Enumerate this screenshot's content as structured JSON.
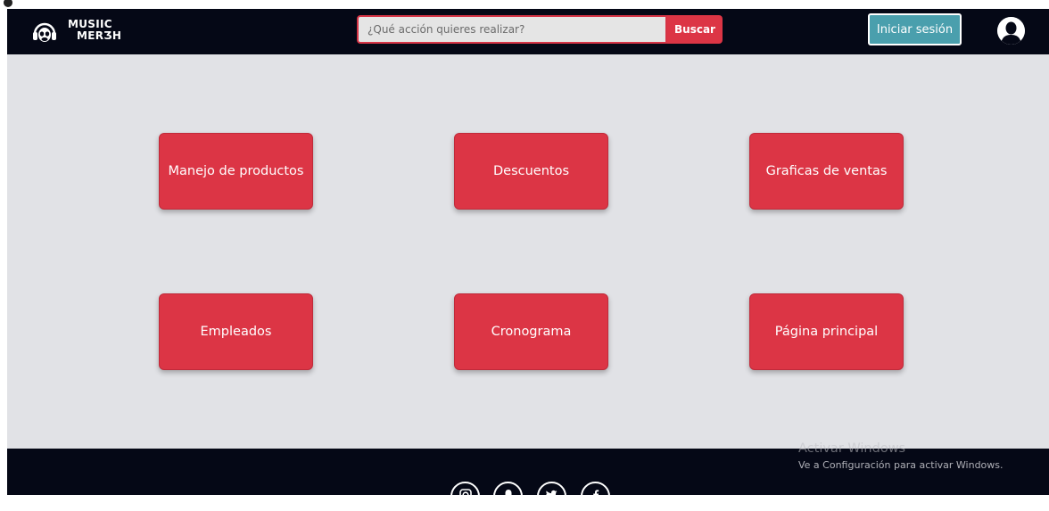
{
  "header": {
    "logo_line1": "MUSIIC",
    "logo_line2": "MERƷH",
    "search": {
      "placeholder": "¿Qué acción quieres realizar?",
      "value": "",
      "button_label": "Buscar"
    },
    "login_label": "Iniciar sesión",
    "logo_icon": "headphones-monkey-logo-icon",
    "avatar_icon": "user-avatar-icon"
  },
  "tiles": [
    {
      "label": "Manejo de productos"
    },
    {
      "label": "Descuentos"
    },
    {
      "label": "Graficas de ventas"
    },
    {
      "label": "Empleados"
    },
    {
      "label": "Cronograma"
    },
    {
      "label": "Página principal"
    }
  ],
  "footer": {
    "social_icons": [
      "instagram-icon",
      "snapchat-icon",
      "twitter-icon",
      "facebook-icon"
    ]
  },
  "watermark": {
    "title": "Activar Windows",
    "subtitle": "Ve a Configuración para activar Windows."
  },
  "colors": {
    "navbar_bg": "#050816",
    "accent_red": "#dc3545",
    "login_teal": "#4a9fad",
    "main_bg": "#e1e2e6"
  }
}
